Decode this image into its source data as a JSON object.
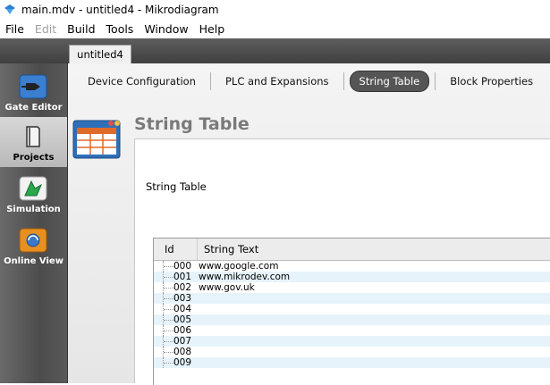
{
  "window": {
    "title": "main.mdv - untitled4 - Mikrodiagram"
  },
  "menu": [
    {
      "label": "File",
      "enabled": true
    },
    {
      "label": "Edit",
      "enabled": false
    },
    {
      "label": "Build",
      "enabled": true
    },
    {
      "label": "Tools",
      "enabled": true
    },
    {
      "label": "Window",
      "enabled": true
    },
    {
      "label": "Help",
      "enabled": true
    }
  ],
  "document_tab": "untitled4",
  "sidebar": {
    "items": [
      {
        "label": "Gate Editor",
        "icon": "gate-editor-icon"
      },
      {
        "label": "Projects",
        "icon": "projects-icon",
        "active": true
      },
      {
        "label": "Simulation",
        "icon": "simulation-icon"
      },
      {
        "label": "Online View",
        "icon": "online-view-icon"
      }
    ]
  },
  "subtabs": [
    {
      "label": "Device Configuration"
    },
    {
      "label": "PLC and Expansions"
    },
    {
      "label": "String Table",
      "active": true
    },
    {
      "label": "Block Properties"
    }
  ],
  "page": {
    "title": "String Table",
    "section_label": "String Table"
  },
  "table": {
    "headers": {
      "id": "Id",
      "text": "String Text"
    },
    "rows": [
      {
        "id": "000",
        "text": "www.google.com"
      },
      {
        "id": "001",
        "text": "www.mikrodev.com"
      },
      {
        "id": "002",
        "text": "www.gov.uk"
      },
      {
        "id": "003",
        "text": ""
      },
      {
        "id": "004",
        "text": ""
      },
      {
        "id": "005",
        "text": ""
      },
      {
        "id": "006",
        "text": ""
      },
      {
        "id": "007",
        "text": ""
      },
      {
        "id": "008",
        "text": ""
      },
      {
        "id": "009",
        "text": ""
      }
    ]
  },
  "colors": {
    "accent_tab": "#555555",
    "row_alt": "#e6f3fb",
    "sidebar": "#595959"
  }
}
